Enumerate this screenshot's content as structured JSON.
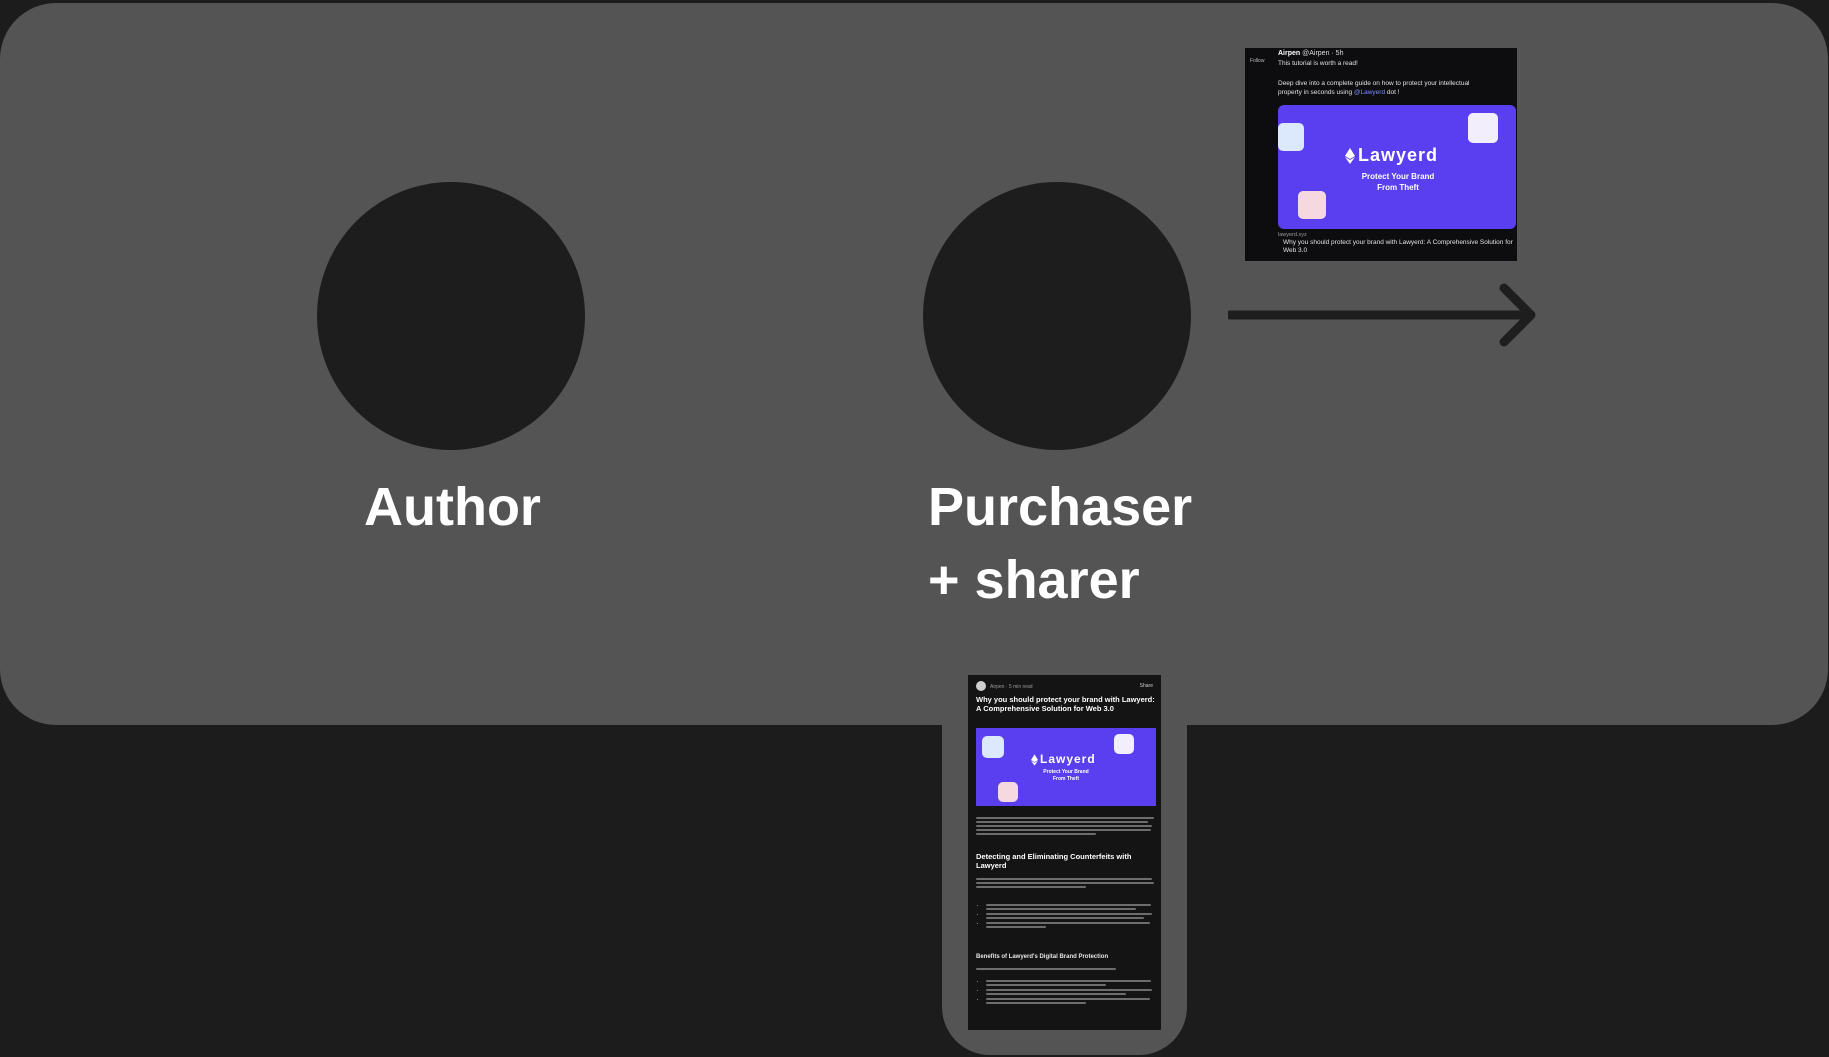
{
  "nodes": {
    "author_label": "Author",
    "purchaser_label_line1": "Purchaser",
    "purchaser_label_line2": "+ sharer"
  },
  "tweet": {
    "avatar_text": "Follow",
    "author_name": "Airpen",
    "handle_time": "@Airpen · 5h",
    "text_line1": "This tutorial is worth a read!",
    "text_line2": "Deep dive into a complete guide on how to protect your intellectual",
    "text_line3_pre": "property in seconds using ",
    "text_line3_link": "@Lawyerd",
    "text_line3_post": " dot !",
    "banner_brand": "Lawyerd",
    "banner_tagline_line1": "Protect Your Brand",
    "banner_tagline_line2": "From Theft",
    "meta": "lawyerd.xyz",
    "caption": "Why you should protect your brand with Lawyerd: A Comprehensive Solution for Web 3.0"
  },
  "article": {
    "header_meta": "Airpen · 5 min read",
    "share_label": "Share",
    "title": "Why you should protect your brand with Lawyerd: A Comprehensive Solution for Web 3.0",
    "banner_brand": "Lawyerd",
    "banner_tagline_line1": "Protect Your Brand",
    "banner_tagline_line2": "From Theft",
    "heading1": "Detecting and Eliminating Counterfeits with Lawyerd",
    "heading2": "Benefits of Lawyerd's Digital Brand Protection"
  },
  "colors": {
    "background": "#1c1c1c",
    "panel": "#545454",
    "node": "#1d1d1d",
    "banner_purple": "#5a3ff0",
    "arrow": "#1e1e1e"
  },
  "icons": {
    "arrow": "right-arrow-icon",
    "brand_logo": "ethereum-logo-icon"
  }
}
